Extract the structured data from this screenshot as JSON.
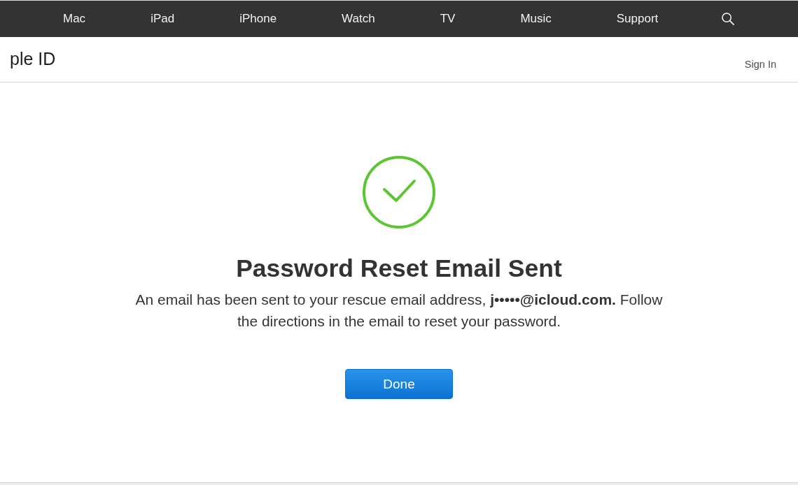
{
  "nav": {
    "items": [
      "Mac",
      "iPad",
      "iPhone",
      "Watch",
      "TV",
      "Music",
      "Support"
    ]
  },
  "header": {
    "title": "ple ID",
    "links": [
      "Sign In"
    ]
  },
  "confirmation": {
    "title": "Password Reset Email Sent",
    "message": "An email has been sent to your rescue email address, **j•••••@icloud.com.** Follow the directions in the email to reset your password.",
    "button": "Done"
  }
}
